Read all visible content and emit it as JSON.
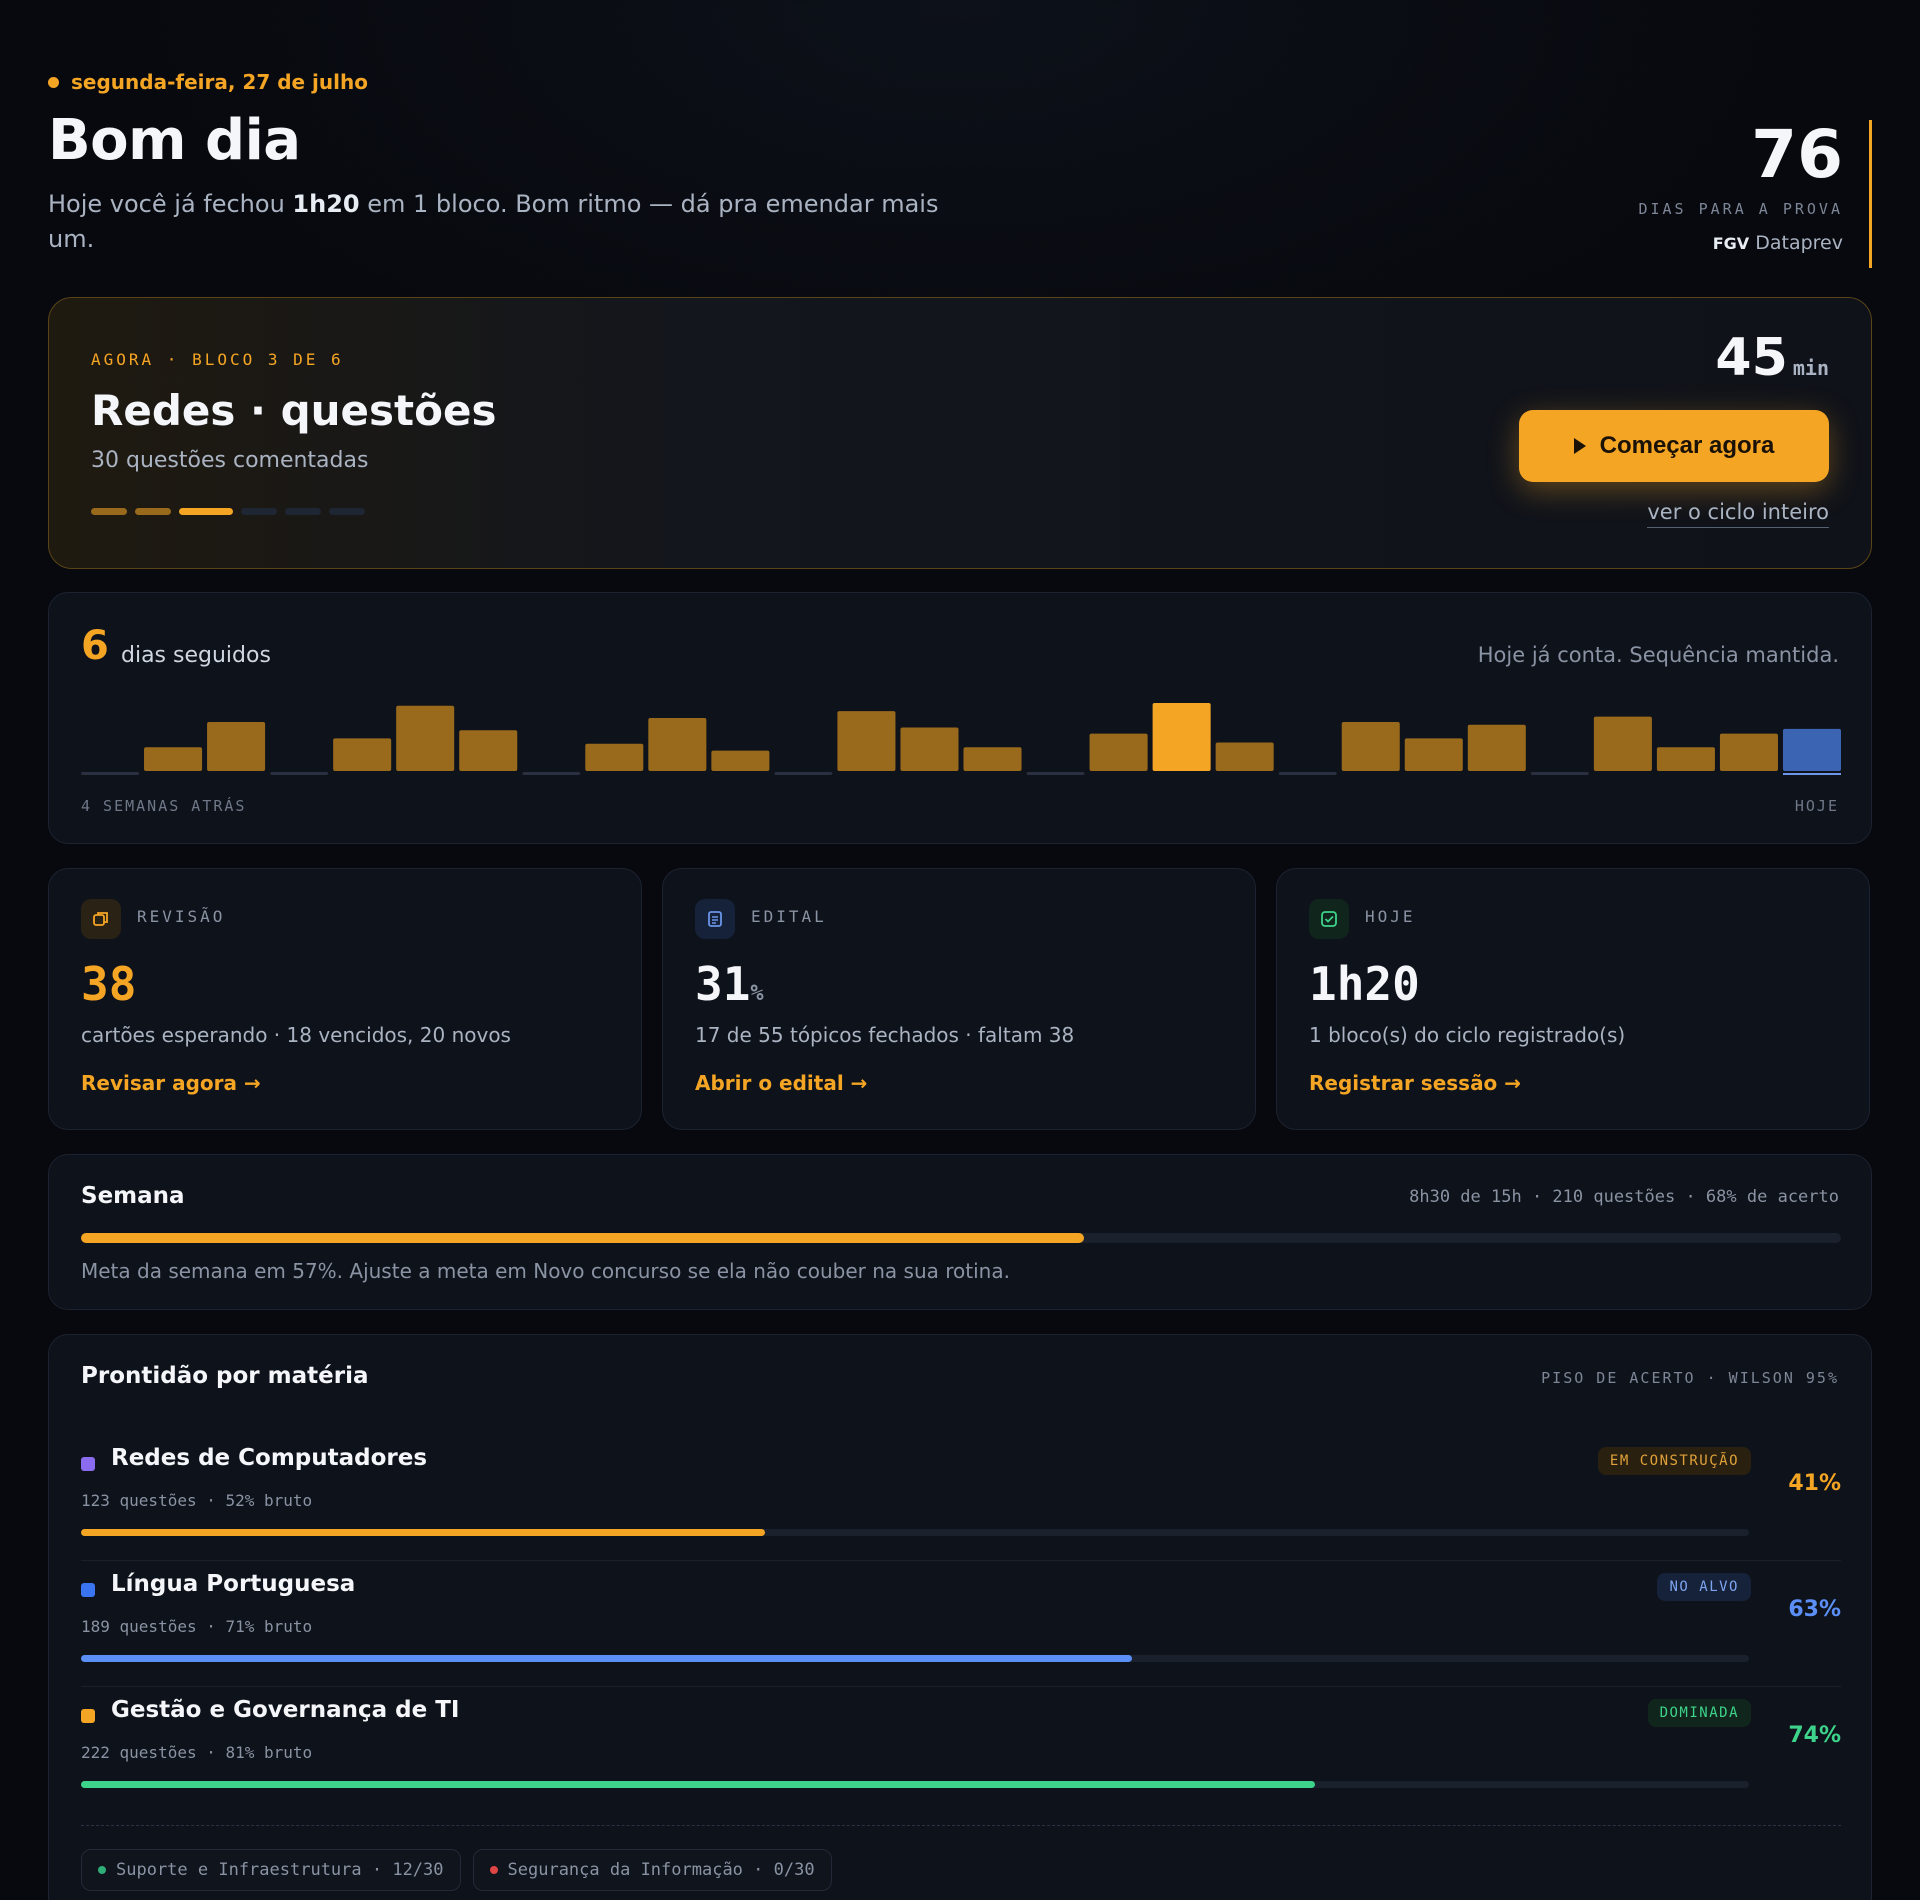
{
  "header": {
    "date": "segunda-feira, 27 de julho",
    "greeting": "Bom dia",
    "summary_pre": "Hoje você já fechou ",
    "summary_bold": "1h20",
    "summary_post": " em 1 bloco. Bom ritmo — dá pra emendar mais um.",
    "countdown_value": "76",
    "countdown_label": "DIAS PARA A PROVA",
    "exam_board": "FGV",
    "exam_name": "Dataprev"
  },
  "now_block": {
    "kicker": "AGORA · BLOCO 3 DE 6",
    "title": "Redes · questões",
    "subtitle": "30 questões comentadas",
    "duration_value": "45",
    "duration_unit": "min",
    "start_label": "Começar agora",
    "cycle_link": "ver o ciclo inteiro",
    "steps_total": 6,
    "steps_current": 3
  },
  "streak": {
    "count": "6",
    "label": "dias seguidos",
    "note": "Hoje já conta. Sequência mantida.",
    "left_label": "4 SEMANAS ATRÁS",
    "right_label": "HOJE",
    "days": [
      0,
      0.35,
      0.72,
      0,
      0.48,
      0.96,
      0.6,
      0,
      0.4,
      0.78,
      0.3,
      0,
      0.88,
      0.64,
      0.35,
      0,
      0.55,
      1.0,
      0.42,
      0,
      0.72,
      0.48,
      0.68,
      0,
      0.8,
      0.35,
      0.55,
      0.62
    ],
    "highlight_index": 17,
    "today_index": 27,
    "colors": {
      "bar": "#9a6a1c",
      "highlight": "#f5a524",
      "today": "#3b64b3",
      "empty": "#2a3040"
    }
  },
  "stats": [
    {
      "kicker": "REVISÃO",
      "value": "38",
      "unit": "",
      "description": "cartões esperando · 18 vencidos, 20 novos",
      "action": "Revisar agora →",
      "icon": "cards-icon",
      "value_color": "#f5a524",
      "icon_bg": "#2a2214",
      "icon_color": "#f5a524"
    },
    {
      "kicker": "EDITAL",
      "value": "31",
      "unit": "%",
      "description": "17 de 55 tópicos fechados · faltam 38",
      "action": "Abrir o edital →",
      "icon": "document-icon",
      "value_color": "#f4f6fa",
      "icon_bg": "#16223a",
      "icon_color": "#6b95e8"
    },
    {
      "kicker": "HOJE",
      "value": "1h20",
      "unit": "",
      "description": "1 bloco(s) do ciclo registrado(s)",
      "action": "Registrar sessão →",
      "icon": "check-square-icon",
      "value_color": "#f4f6fa",
      "icon_bg": "#10261d",
      "icon_color": "#3ed38a"
    }
  ],
  "week": {
    "title": "Semana",
    "stats": "8h30 de 15h · 210 questões · 68% de acerto",
    "progress": 0.57,
    "note": "Meta da semana em 57%. Ajuste a meta em Novo concurso se ela não couber na sua rotina."
  },
  "subjects": {
    "title": "Prontidão por matéria",
    "meta": "PISO DE ACERTO · WILSON 95%",
    "rows": [
      {
        "name": "Redes de Computadores",
        "meta": "123 questões · 52% bruto",
        "badge": "EM CONSTRUÇÃO",
        "percent": "41%",
        "value": 0.41,
        "square_color": "#8b6cf0",
        "bar_color": "#f5a524",
        "pct_color": "#f5a524",
        "badge_bg": "#2a2010",
        "badge_fg": "#e0a13a"
      },
      {
        "name": "Língua Portuguesa",
        "meta": "189 questões · 71% bruto",
        "badge": "NO ALVO",
        "percent": "63%",
        "value": 0.63,
        "square_color": "#3b74f0",
        "bar_color": "#5b8ff5",
        "pct_color": "#5b8ff5",
        "badge_bg": "#16223a",
        "badge_fg": "#7ea4f0"
      },
      {
        "name": "Gestão e Governança de TI",
        "meta": "222 questões · 81% bruto",
        "badge": "DOMINADA",
        "percent": "74%",
        "value": 0.74,
        "square_color": "#f5a524",
        "bar_color": "#3ed38a",
        "pct_color": "#3ed38a",
        "badge_bg": "#10261d",
        "badge_fg": "#3ed38a"
      }
    ],
    "chips": [
      {
        "label": "Suporte e Infraestrutura · 12/30",
        "dot": "#2fae78"
      },
      {
        "label": "Segurança da Informação · 0/30",
        "dot": "#e04545"
      }
    ]
  }
}
